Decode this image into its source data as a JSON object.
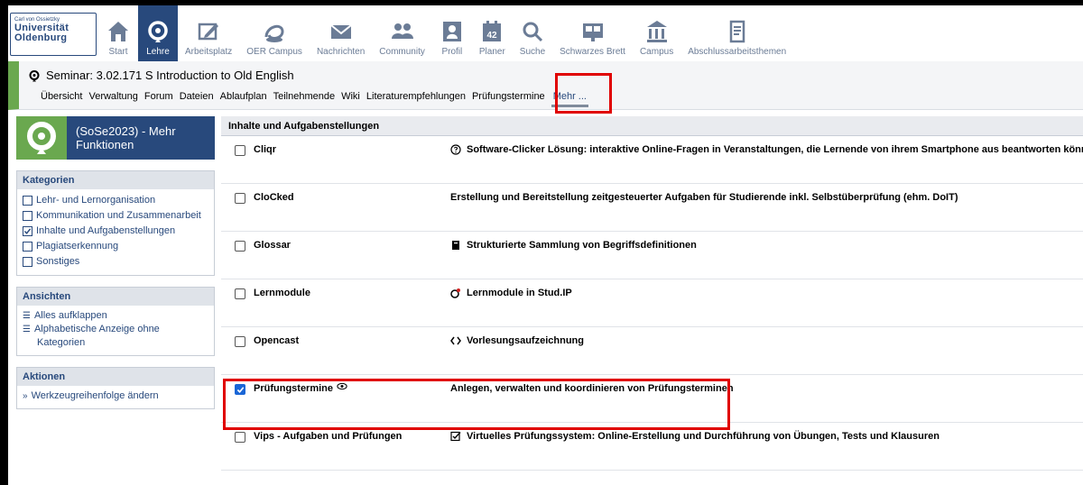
{
  "logo": {
    "line1": "Carl von Ossietzky",
    "line2": "Universität",
    "line3": "Oldenburg"
  },
  "nav": [
    {
      "label": "Start",
      "icon": "home-icon"
    },
    {
      "label": "Lehre",
      "icon": "seminar-icon",
      "active": true
    },
    {
      "label": "Arbeitsplatz",
      "icon": "workplace-icon"
    },
    {
      "label": "OER Campus",
      "icon": "oer-icon"
    },
    {
      "label": "Nachrichten",
      "icon": "mail-icon"
    },
    {
      "label": "Community",
      "icon": "community-icon"
    },
    {
      "label": "Profil",
      "icon": "profile-icon"
    },
    {
      "label": "Planer",
      "icon": "calendar-icon",
      "day": "42"
    },
    {
      "label": "Suche",
      "icon": "search-icon"
    },
    {
      "label": "Schwarzes Brett",
      "icon": "board-icon"
    },
    {
      "label": "Campus",
      "icon": "campus-icon"
    },
    {
      "label": "Abschlussarbeitsthemen",
      "icon": "thesis-icon"
    }
  ],
  "context": {
    "title": "Seminar: 3.02.171 S Introduction to Old English",
    "tabs": [
      "Übersicht",
      "Verwaltung",
      "Forum",
      "Dateien",
      "Ablaufplan",
      "Teilnehmende",
      "Wiki",
      "Literaturempfehlungen",
      "Prüfungstermine"
    ],
    "more_tab": "Mehr ..."
  },
  "sidebar": {
    "header": "(SoSe2023) - Mehr Funktionen",
    "header_line1": "(SoSe2023) - Mehr",
    "header_line2": "Funktionen",
    "categories_title": "Kategorien",
    "categories": [
      {
        "label": "Lehr- und Lernorganisation",
        "checked": false
      },
      {
        "label": "Kommunikation und Zusammenarbeit",
        "checked": false
      },
      {
        "label": "Inhalte und Aufgabenstellungen",
        "checked": true
      },
      {
        "label": "Plagiatserkennung",
        "checked": false
      },
      {
        "label": "Sonstiges",
        "checked": false
      }
    ],
    "views_title": "Ansichten",
    "views": [
      "Alles aufklappen",
      "Alphabetische Anzeige ohne",
      "Kategorien"
    ],
    "actions_title": "Aktionen",
    "actions": [
      "Werkzeugreihenfolge ändern"
    ]
  },
  "main": {
    "section_title": "Inhalte und Aufgabenstellungen",
    "tools": [
      {
        "name": "Cliqr",
        "checked": false,
        "desc": "Software-Clicker Lösung: interaktive Online-Fragen in Veranstaltungen, die Lernende von ihrem Smartphone aus beantworten können.",
        "icon": "help-circle-icon"
      },
      {
        "name": "CloCked",
        "checked": false,
        "desc": "Erstellung und Bereitstellung zeitgesteuerter Aufgaben für Studierende inkl. Selbstüberprüfung (ehm. DoIT)",
        "icon": ""
      },
      {
        "name": "Glossar",
        "checked": false,
        "desc": "Strukturierte Sammlung von Begriffsdefinitionen",
        "icon": "book-icon"
      },
      {
        "name": "Lernmodule",
        "checked": false,
        "desc": "Lernmodule in Stud.IP",
        "icon": "learning-module-icon"
      },
      {
        "name": "Opencast",
        "checked": false,
        "desc": "Vorlesungsaufzeichnung",
        "icon": "code-arrows-icon"
      },
      {
        "name": "Prüfungstermine",
        "checked": true,
        "desc": "Anlegen, verwalten und koordinieren von Prüfungsterminen",
        "icon": "",
        "visible_icon": "eye-icon"
      },
      {
        "name": "Vips - Aufgaben und Prüfungen",
        "checked": false,
        "desc": "Virtuelles Prüfungssystem: Online-Erstellung und Durchführung von Übungen, Tests und Klausuren",
        "icon": "checkbox-icon"
      }
    ]
  }
}
